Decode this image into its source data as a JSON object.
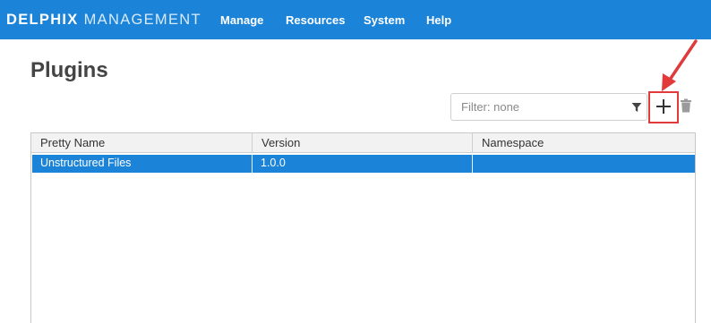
{
  "app": {
    "brand_bold": "DELPHIX",
    "brand_light": "MANAGEMENT"
  },
  "nav": {
    "items": [
      {
        "label": "Manage"
      },
      {
        "label": "Resources"
      },
      {
        "label": "System"
      },
      {
        "label": "Help"
      }
    ]
  },
  "page": {
    "title": "Plugins"
  },
  "filter": {
    "placeholder": "Filter: none",
    "value": "",
    "icon": "filter-icon"
  },
  "toolbar": {
    "add_icon": "plus-icon",
    "delete_icon": "trash-icon",
    "annotation_color": "#e03a3a"
  },
  "table": {
    "columns": [
      "Pretty Name",
      "Version",
      "Namespace"
    ],
    "rows": [
      {
        "pretty_name": "Unstructured Files",
        "version": "1.0.0",
        "namespace": "",
        "selected": true
      }
    ]
  },
  "colors": {
    "topbar": "#1b84d8",
    "selected_row": "#1b84d8",
    "title_text": "#444444",
    "header_bg": "#f2f2f2"
  }
}
